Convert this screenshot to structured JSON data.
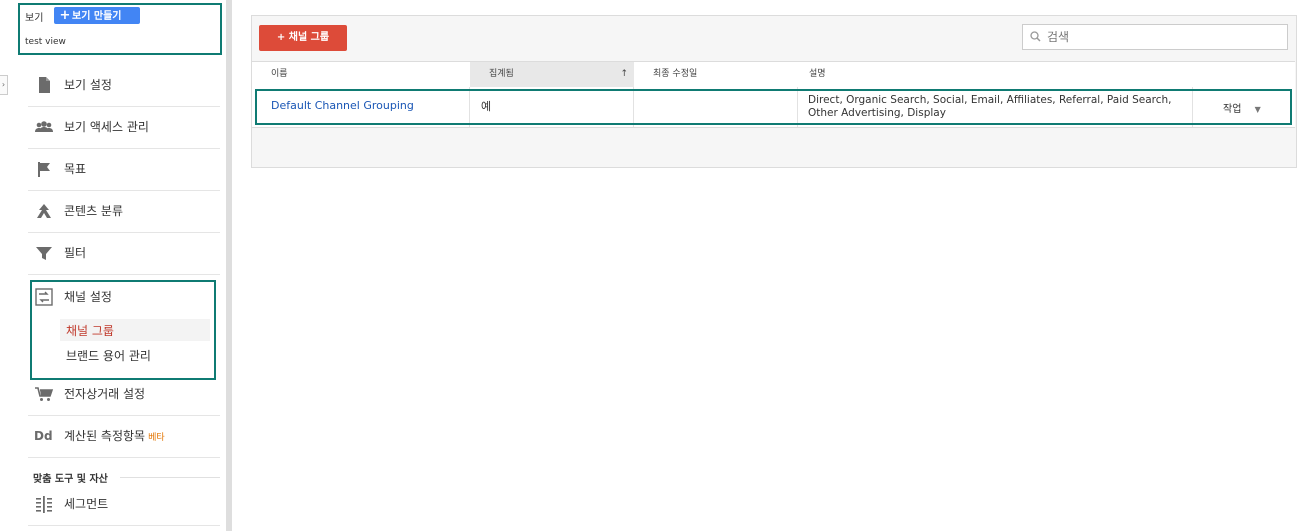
{
  "sidebar": {
    "view_label": "보기",
    "create_view_label": "보기 만들기",
    "view_name": "test view",
    "items": [
      {
        "label": "보기 설정",
        "icon": "document-icon"
      },
      {
        "label": "보기 액세스 관리",
        "icon": "users-icon"
      },
      {
        "label": "목표",
        "icon": "flag-icon"
      },
      {
        "label": "콘텐츠 분류",
        "icon": "content-grouping-icon"
      },
      {
        "label": "필터",
        "icon": "filter-icon"
      },
      {
        "label": "채널 설정",
        "icon": "channel-settings-icon"
      },
      {
        "label": "전자상거래 설정",
        "icon": "cart-icon"
      },
      {
        "label": "계산된 측정항목",
        "icon": "dd-icon",
        "badge": "베타",
        "icon_text": "Dd"
      }
    ],
    "channel_subitems": [
      {
        "label": "채널 그룹",
        "active": true
      },
      {
        "label": "브랜드 용어 관리",
        "active": false
      }
    ],
    "section_heading": "맞춤 도구 및 자산",
    "section_items": [
      {
        "label": "세그먼트",
        "icon": "segment-icon"
      }
    ]
  },
  "main": {
    "add_button_label": "+ 채널 그룹",
    "search_placeholder": "검색",
    "table": {
      "columns": [
        "이름",
        "집계됨",
        "최종 수정일",
        "설명"
      ],
      "sort_indicator": "↑",
      "rows": [
        {
          "name": "Default Channel Grouping",
          "aggregated": "예",
          "modified": "",
          "description": "Direct, Organic Search, Social, Email, Affiliates, Referral, Paid Search, Other Advertising, Display",
          "action": "작업"
        }
      ]
    }
  },
  "colors": {
    "highlight_outline": "#0f7b73",
    "primary_button": "#4285f4",
    "danger_button": "#dd4b39",
    "active_link": "#c0392b",
    "link": "#1a56b5",
    "beta": "#e37400"
  }
}
